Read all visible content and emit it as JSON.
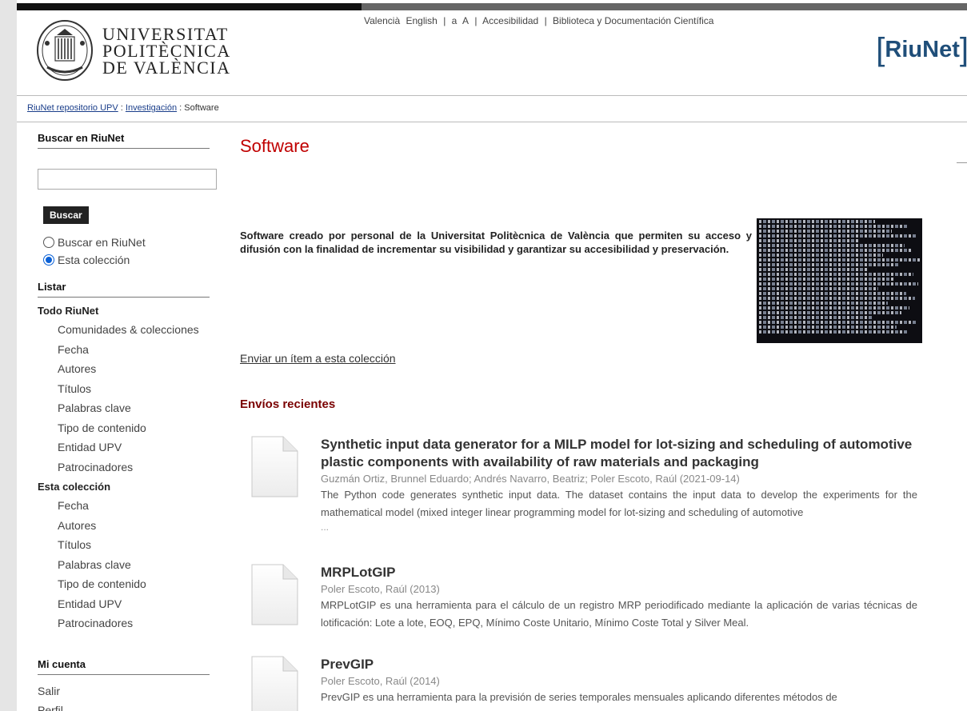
{
  "header": {
    "logo_text": [
      "UNIVERSITAT",
      "POLITÈCNICA",
      "DE VALÈNCIA"
    ],
    "top_links": [
      {
        "label": "Valencià"
      },
      {
        "label": "English"
      },
      {
        "label": "|"
      },
      {
        "label": "a"
      },
      {
        "label": "A"
      },
      {
        "label": "|"
      },
      {
        "label": "Accesibilidad"
      },
      {
        "label": "|"
      },
      {
        "label": "Biblioteca y Documentación Científica"
      }
    ],
    "brand": "RiuNet"
  },
  "breadcrumb": {
    "root": "RiuNet repositorio UPV",
    "sep1": " : ",
    "parent": "Investigación",
    "sep2": " : ",
    "current": "Software"
  },
  "sidebar": {
    "search_title": "Buscar en RiuNet",
    "search_value": "",
    "search_button": "Buscar",
    "radio_options": [
      {
        "label": "Buscar en RiuNet",
        "selected": false
      },
      {
        "label": "Esta colección",
        "selected": true
      }
    ],
    "listar_title": "Listar",
    "todo_title": "Todo RiuNet",
    "todo_items": [
      "Comunidades & colecciones",
      "Fecha",
      "Autores",
      "Títulos",
      "Palabras clave",
      "Tipo de contenido",
      "Entidad UPV",
      "Patrocinadores"
    ],
    "coleccion_title": "Esta colección",
    "coleccion_items": [
      "Fecha",
      "Autores",
      "Títulos",
      "Palabras clave",
      "Tipo de contenido",
      "Entidad UPV",
      "Patrocinadores"
    ],
    "cuenta_title": "Mi cuenta",
    "cuenta_items": [
      "Salir",
      "Perfil"
    ]
  },
  "main": {
    "title": "Software",
    "description": "Software creado por personal de la Universitat Politècnica de València que permiten su acceso y difusión con la finalidad de incrementar su visibilidad y garantizar su accesibilidad y preservación.",
    "submit_link": "Enviar un ítem a esta colección",
    "recent_title": "Envíos recientes",
    "items": [
      {
        "title": "Synthetic input data generator for a MILP model for lot-sizing and scheduling of automotive plastic components with availability of raw materials and packaging",
        "meta": "Guzmán Ortiz, Brunnel Eduardo; Andrés Navarro, Beatriz; Poler Escoto, Raúl (2021-09-14)",
        "abstract": "The Python code generates synthetic input data. The dataset contains the input data to develop the experiments for the mathematical model (mixed integer linear programming model for lot-sizing and scheduling of automotive",
        "ellipsis": "..."
      },
      {
        "title": "MRPLotGIP",
        "meta": "Poler Escoto, Raúl (2013)",
        "abstract": "MRPLotGIP es una herramienta para el cálculo de un registro MRP periodificado mediante la aplicación de varias técnicas de lotificación: Lote a lote, EOQ, EPQ, Mínimo Coste Unitario, Mínimo Coste Total y Silver Meal.",
        "ellipsis": ""
      },
      {
        "title": "PrevGIP",
        "meta": "Poler Escoto, Raúl (2014)",
        "abstract": "PrevGIP es una herramienta para la previsión de series temporales mensuales aplicando diferentes métodos de",
        "ellipsis": ""
      }
    ]
  }
}
